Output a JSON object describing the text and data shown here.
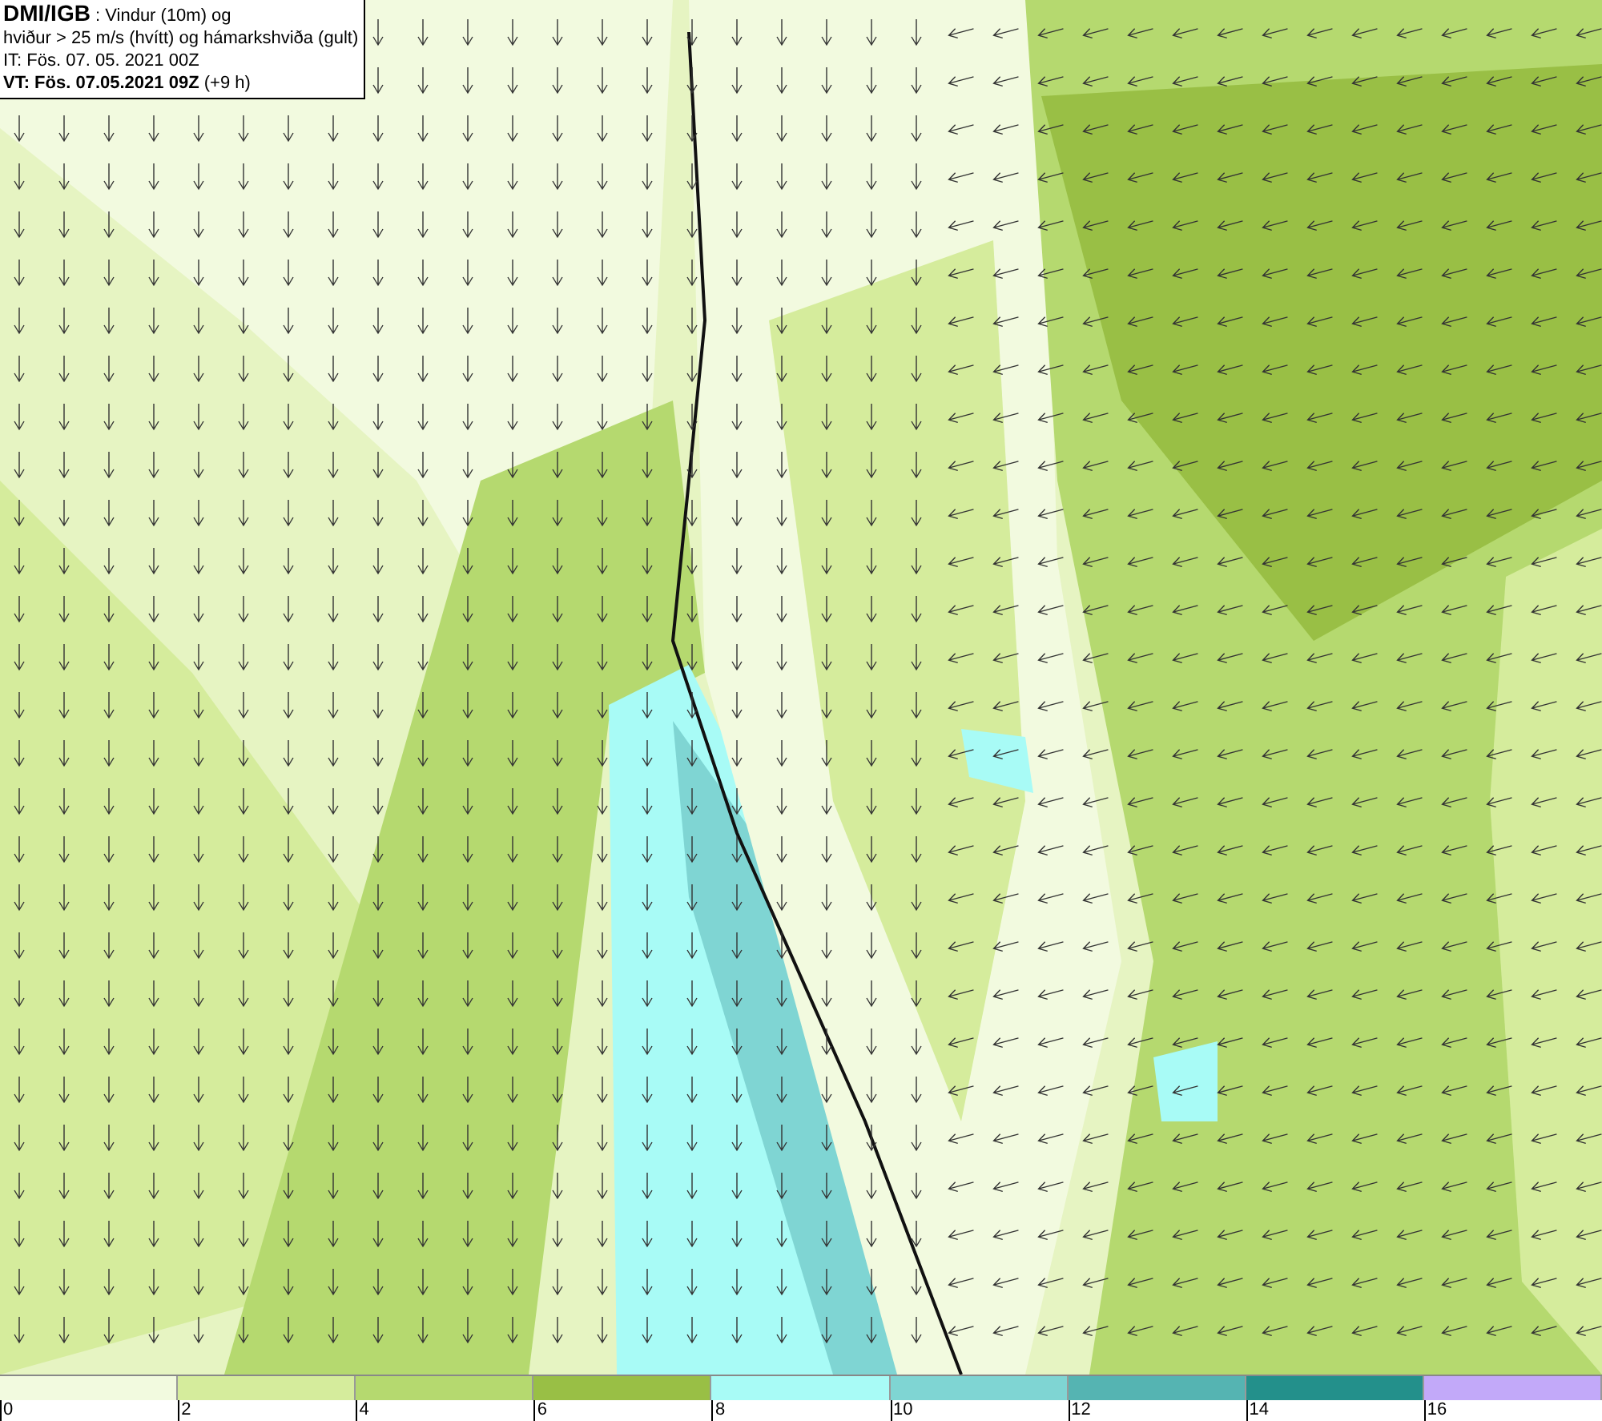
{
  "header": {
    "lines": [
      "**DMI/IGB** : Vindur (10m) og",
      "hviður > 25 m/s (hvítt) og hámarkshviða (gult)",
      "IT: Fös. 07. 05. 2021 00Z",
      "**VT: Fös. 07.05.2021 09Z** (+9 h)"
    ]
  },
  "legend": {
    "segments": [
      {
        "color": "#f2fadf"
      },
      {
        "color": "#d5ec9c"
      },
      {
        "color": "#b5d96f"
      },
      {
        "color": "#99bf45"
      },
      {
        "color": "#a8fbf6"
      },
      {
        "color": "#7fd5d3"
      },
      {
        "color": "#55b4b2"
      },
      {
        "color": "#23908b"
      },
      {
        "color": "#c2a9f9"
      }
    ],
    "ticks": [
      "0",
      "2",
      "4",
      "6",
      "8",
      "10",
      "12",
      "14",
      "16"
    ]
  }
}
